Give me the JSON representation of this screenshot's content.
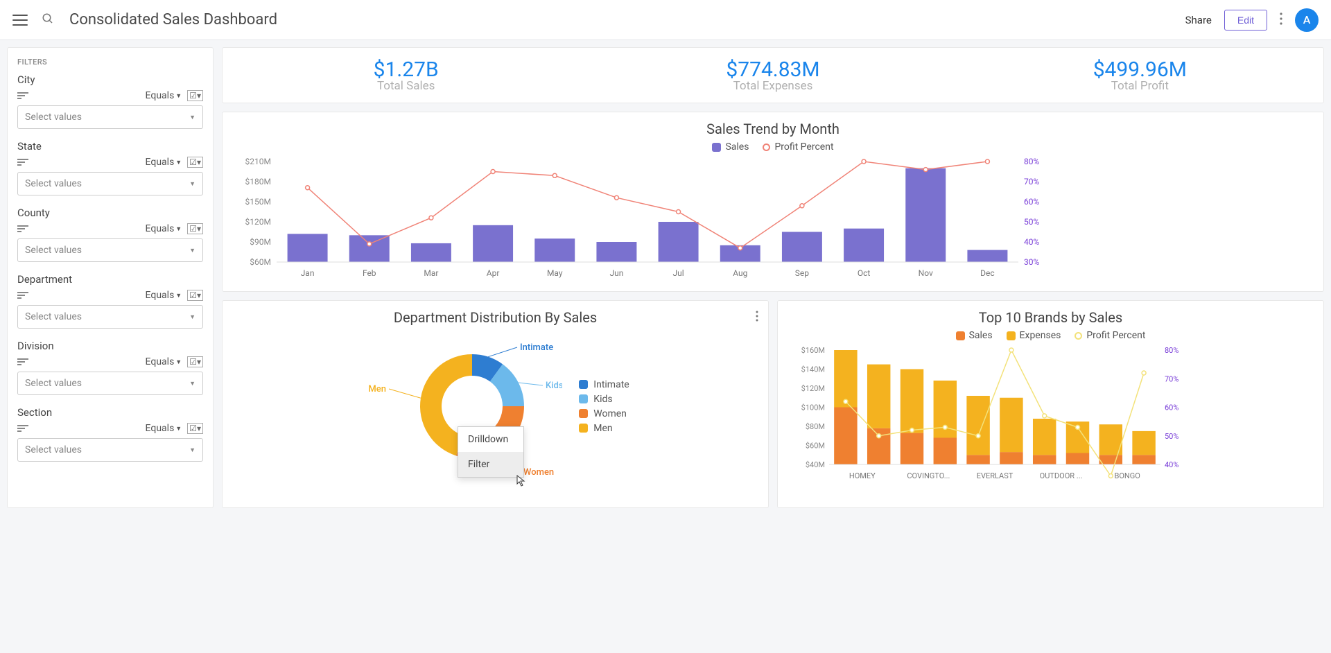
{
  "header": {
    "title": "Consolidated Sales Dashboard",
    "share": "Share",
    "edit": "Edit",
    "avatar": "A"
  },
  "sidebar": {
    "title": "FILTERS",
    "filters": [
      {
        "label": "City",
        "op": "Equals",
        "placeholder": "Select values"
      },
      {
        "label": "State",
        "op": "Equals",
        "placeholder": "Select values"
      },
      {
        "label": "County",
        "op": "Equals",
        "placeholder": "Select values"
      },
      {
        "label": "Department",
        "op": "Equals",
        "placeholder": "Select values"
      },
      {
        "label": "Division",
        "op": "Equals",
        "placeholder": "Select values"
      },
      {
        "label": "Section",
        "op": "Equals",
        "placeholder": "Select values"
      }
    ]
  },
  "kpis": [
    {
      "value": "$1.27B",
      "label": "Total Sales"
    },
    {
      "value": "$774.83M",
      "label": "Total Expenses"
    },
    {
      "value": "$499.96M",
      "label": "Total Profit"
    }
  ],
  "trend": {
    "title": "Sales Trend by Month",
    "legend": {
      "sales": "Sales",
      "profit": "Profit Percent"
    }
  },
  "dept": {
    "title": "Department Distribution By Sales",
    "legend": [
      "Intimate",
      "Kids",
      "Women",
      "Men"
    ],
    "callouts": {
      "intimate": "Intimate",
      "kids": "Kids",
      "women": "Women",
      "men": "Men"
    },
    "colors": {
      "intimate": "#2e7dd1",
      "kids": "#6cb9eb",
      "women": "#ef8030",
      "men": "#f4b21f"
    }
  },
  "brands": {
    "title": "Top 10 Brands by Sales",
    "legend": {
      "sales": "Sales",
      "expenses": "Expenses",
      "profit": "Profit Percent"
    }
  },
  "context_menu": {
    "drilldown": "Drilldown",
    "filter": "Filter"
  },
  "chart_data": [
    {
      "id": "sales_trend",
      "type": "bar+line",
      "categories": [
        "Jan",
        "Feb",
        "Mar",
        "Apr",
        "May",
        "Jun",
        "Jul",
        "Aug",
        "Sep",
        "Oct",
        "Nov",
        "Dec"
      ],
      "series": [
        {
          "name": "Sales",
          "axis": "left",
          "type": "bar",
          "values": [
            102,
            100,
            88,
            115,
            95,
            90,
            120,
            85,
            105,
            110,
            200,
            78
          ],
          "unit": "M",
          "color": "#7a71cf"
        },
        {
          "name": "Profit Percent",
          "axis": "right",
          "type": "line",
          "values": [
            67,
            39,
            52,
            75,
            73,
            62,
            55,
            37,
            58,
            80,
            76,
            80
          ],
          "unit": "%",
          "color": "#f08377"
        }
      ],
      "y_left": {
        "ticks": [
          "$60M",
          "$90M",
          "$120M",
          "$150M",
          "$180M",
          "$210M"
        ],
        "range": [
          60,
          210
        ]
      },
      "y_right": {
        "ticks": [
          "30%",
          "40%",
          "50%",
          "60%",
          "70%",
          "80%"
        ],
        "range": [
          30,
          80
        ],
        "color": "#7a3fd8"
      }
    },
    {
      "id": "dept_distribution",
      "type": "donut",
      "slices": [
        {
          "name": "Intimate",
          "value": 10,
          "color": "#2e7dd1"
        },
        {
          "name": "Kids",
          "value": 15,
          "color": "#6cb9eb"
        },
        {
          "name": "Women",
          "value": 30,
          "color": "#ef8030"
        },
        {
          "name": "Men",
          "value": 45,
          "color": "#f4b21f"
        }
      ]
    },
    {
      "id": "top_brands",
      "type": "stacked-bar+line",
      "categories": [
        "HOMEY",
        "COVINGTO...",
        "EVERLAST",
        "OUTDOOR ...",
        "BONGO"
      ],
      "series": [
        {
          "name": "Sales",
          "axis": "left",
          "type": "bar",
          "color": "#ef8030",
          "values": [
            100,
            78,
            73,
            68,
            50,
            53,
            50,
            52,
            50,
            50
          ]
        },
        {
          "name": "Expenses",
          "axis": "left",
          "type": "bar",
          "color": "#f4b21f",
          "values": [
            60,
            67,
            67,
            60,
            62,
            57,
            38,
            33,
            32,
            25
          ]
        },
        {
          "name": "Profit Percent",
          "axis": "right",
          "type": "line",
          "color": "#f3e27a",
          "values": [
            62,
            50,
            52,
            53,
            50,
            80,
            57,
            53,
            36,
            72
          ]
        }
      ],
      "y_left": {
        "ticks": [
          "$40M",
          "$60M",
          "$80M",
          "$100M",
          "$120M",
          "$140M",
          "$160M"
        ],
        "range": [
          40,
          160
        ]
      },
      "y_right": {
        "ticks": [
          "40%",
          "50%",
          "60%",
          "70%",
          "80%"
        ],
        "range": [
          40,
          80
        ],
        "color": "#7a3fd8"
      }
    }
  ]
}
